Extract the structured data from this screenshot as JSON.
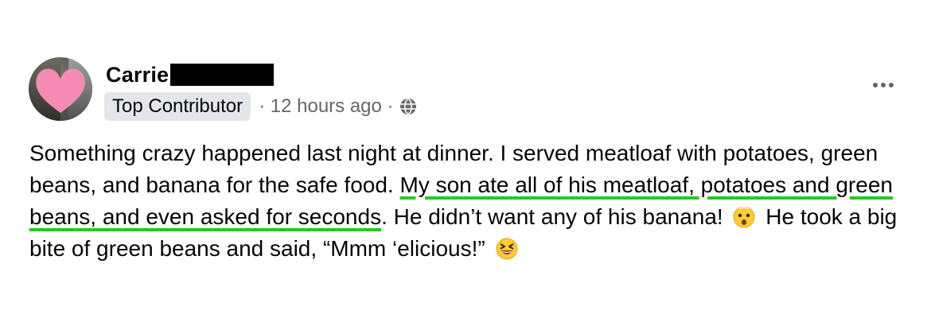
{
  "post": {
    "author": {
      "name": "Carrie",
      "surname_redacted": true
    },
    "badge": "Top Contributor",
    "timestamp": "· 12 hours ago ·",
    "audience_icon": "globe-icon",
    "more_icon": "more-options-icon",
    "body": {
      "part1": "Something crazy happened last night at dinner. I served meatloaf with potatoes, green beans, and banana for the safe food. ",
      "highlight": "My son ate all of his meatloaf, potatoes and green beans, and even asked for seconds",
      "part2": ". He didn’t want any of his banana! ",
      "emoji1": "shocked-face-emoji",
      "part3": " He took a big bite of green beans and said, “Mmm ‘elicious!” ",
      "emoji2": "grinning-squinting-face-emoji"
    },
    "colors": {
      "highlight_underline": "#1fcc1f",
      "badge_background": "#e4e6eb",
      "meta_text": "#65676b",
      "avatar_heart": "#f48bb4"
    }
  }
}
